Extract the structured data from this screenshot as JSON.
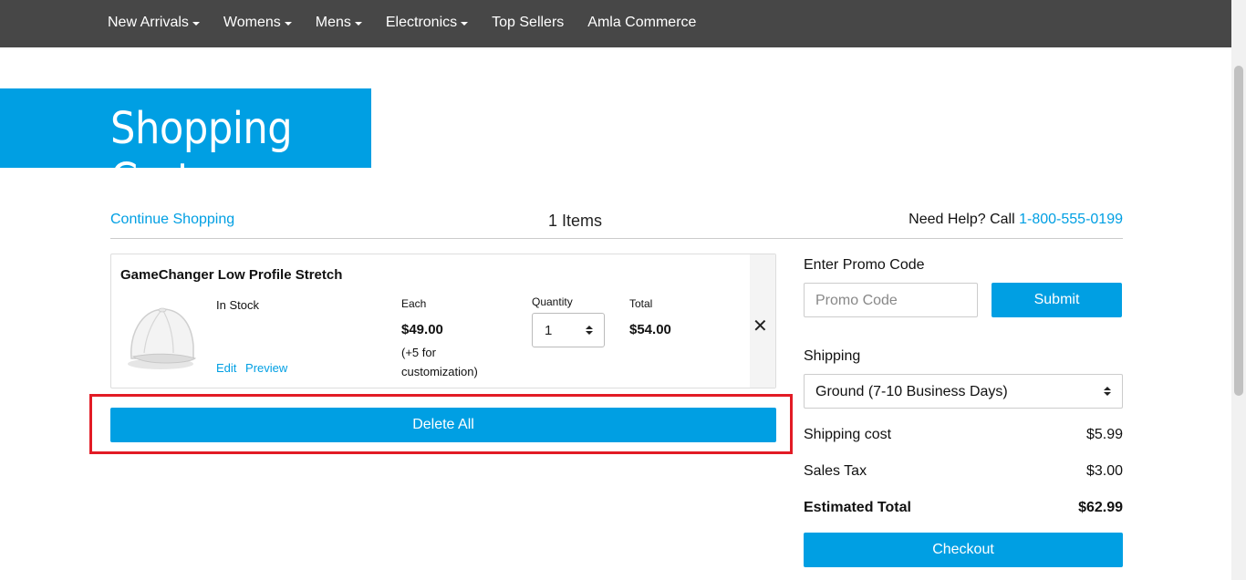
{
  "nav": {
    "items": [
      {
        "label": "New Arrivals",
        "dropdown": true
      },
      {
        "label": "Womens",
        "dropdown": true
      },
      {
        "label": "Mens",
        "dropdown": true
      },
      {
        "label": "Electronics",
        "dropdown": true
      },
      {
        "label": "Top Sellers",
        "dropdown": false
      },
      {
        "label": "Amla Commerce",
        "dropdown": false
      }
    ]
  },
  "page": {
    "title": "Shopping Cart",
    "continue_label": "Continue Shopping",
    "items_count": "1 Items",
    "help_prefix": "Need Help? Call",
    "help_phone": "1-800-555-0199"
  },
  "cart": {
    "product_name": "GameChanger Low Profile Stretch",
    "stock_status": "In Stock",
    "edit_label": "Edit",
    "preview_label": "Preview",
    "each_label": "Each",
    "each_price": "$49.00",
    "price_note": "(+5 for customization)",
    "quantity_label": "Quantity",
    "quantity_value": "1",
    "total_label": "Total",
    "total_value": "$54.00",
    "remove_icon": "close-icon",
    "delete_all_label": "Delete All"
  },
  "summary": {
    "promo_label": "Enter Promo Code",
    "promo_placeholder": "Promo Code",
    "submit_label": "Submit",
    "shipping_label": "Shipping",
    "shipping_option": "Ground (7-10 Business Days)",
    "shipping_cost_label": "Shipping cost",
    "shipping_cost_value": "$5.99",
    "sales_tax_label": "Sales Tax",
    "sales_tax_value": "$3.00",
    "estimated_total_label": "Estimated Total",
    "estimated_total_value": "$62.99",
    "checkout_label": "Checkout"
  },
  "colors": {
    "accent": "#009fe3",
    "nav_bg": "#474747",
    "highlight": "#e21b25"
  }
}
